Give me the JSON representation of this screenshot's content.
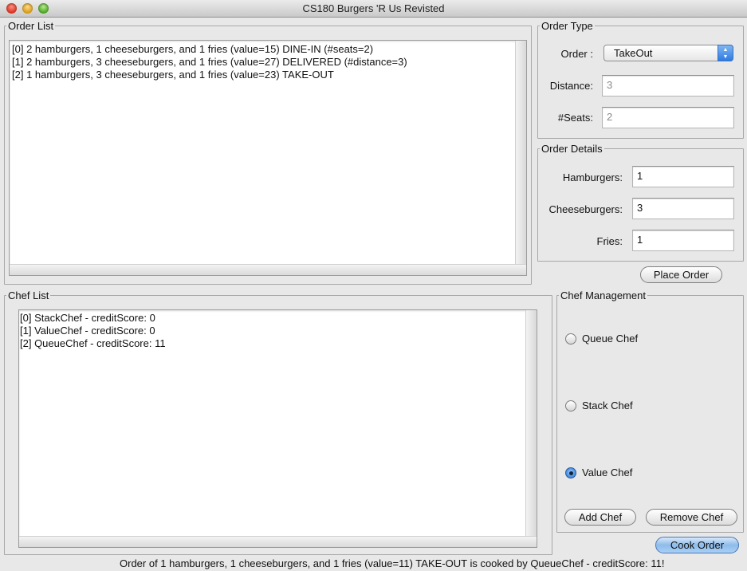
{
  "window": {
    "title": "CS180 Burgers 'R Us Revisted"
  },
  "order_list": {
    "legend": "Order List",
    "items": [
      "[0] 2 hamburgers, 1 cheeseburgers, and 1 fries (value=15) DINE-IN (#seats=2)",
      "[1] 2 hamburgers, 3 cheeseburgers, and 1 fries (value=27) DELIVERED (#distance=3)",
      "[2] 1 hamburgers, 3 cheeseburgers, and 1 fries (value=23) TAKE-OUT"
    ]
  },
  "order_type": {
    "legend": "Order Type",
    "order_label": "Order :",
    "order_value": "TakeOut",
    "distance_label": "Distance:",
    "distance_value": "3",
    "seats_label": "#Seats:",
    "seats_value": "2"
  },
  "order_details": {
    "legend": "Order Details",
    "hamburgers_label": "Hamburgers:",
    "hamburgers_value": "1",
    "cheeseburgers_label": "Cheeseburgers:",
    "cheeseburgers_value": "3",
    "fries_label": "Fries:",
    "fries_value": "1"
  },
  "place_order_label": "Place Order",
  "chef_list": {
    "legend": "Chef List",
    "items": [
      "[0] StackChef - creditScore: 0",
      "[1] ValueChef - creditScore: 0",
      "[2] QueueChef - creditScore: 11"
    ]
  },
  "chef_management": {
    "legend": "Chef Management",
    "options": [
      {
        "label": "Queue Chef",
        "checked": false
      },
      {
        "label": "Stack Chef",
        "checked": false
      },
      {
        "label": "Value Chef",
        "checked": true
      }
    ],
    "add_label": "Add Chef",
    "remove_label": "Remove Chef"
  },
  "cook_order_label": "Cook Order",
  "status_text": "Order of 1 hamburgers, 1 cheeseburgers, and 1 fries (value=11) TAKE-OUT is cooked by QueueChef - creditScore: 11!",
  "colors": {
    "accent": "#3f86df",
    "window_bg": "#e8e8e8"
  },
  "icons": {
    "close": "close-icon",
    "minimize": "minimize-icon",
    "zoom": "zoom-icon",
    "combo": "chevron-updown-icon"
  }
}
